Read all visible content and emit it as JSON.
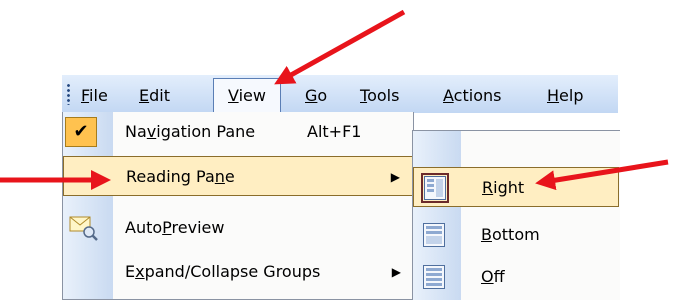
{
  "menubar": {
    "items": [
      {
        "key": "F",
        "rest": "ile"
      },
      {
        "key": "E",
        "pre": "",
        "rest": "dit"
      },
      {
        "key": "V",
        "rest": "iew"
      },
      {
        "key": "G",
        "rest": "o"
      },
      {
        "key": "T",
        "rest": "ools"
      },
      {
        "key": "A",
        "rest": "ctions"
      },
      {
        "key": "H",
        "rest": "elp"
      }
    ]
  },
  "view_menu": {
    "items": [
      {
        "pre": "Na",
        "key": "v",
        "post": "igation Pane",
        "shortcut": "Alt+F1",
        "checked": true
      },
      {
        "pre": "Reading Pa",
        "key": "n",
        "post": "e",
        "submenu": true
      },
      {
        "pre": "Auto",
        "key": "P",
        "post": "review"
      },
      {
        "pre": "E",
        "key": "x",
        "post": "pand/Collapse Groups",
        "submenu": true
      }
    ],
    "check_glyph": "✔",
    "submenu_arrow": "▶"
  },
  "reading_pane_submenu": {
    "items": [
      {
        "pre": "",
        "key": "R",
        "post": "ight",
        "icon": "reading-pane-right-icon"
      },
      {
        "pre": "",
        "key": "B",
        "post": "ottom",
        "icon": "reading-pane-bottom-icon"
      },
      {
        "pre": "",
        "key": "O",
        "post": "ff",
        "icon": "reading-pane-off-icon"
      }
    ]
  },
  "colors": {
    "highlight": "#ffeec2",
    "arrow": "#e8141b",
    "menubar_top": "#e3eefc",
    "menubar_bottom": "#c2d7f3"
  }
}
